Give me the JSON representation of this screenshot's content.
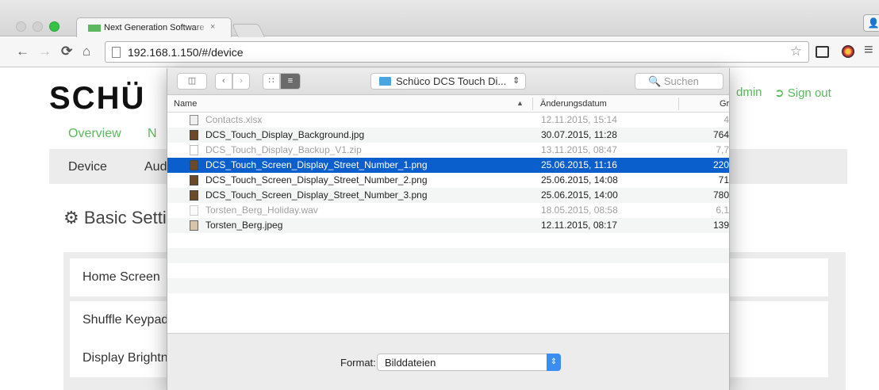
{
  "browser": {
    "tab_title": "Next Generation Software",
    "tab_close": "×",
    "url": "192.168.1.150/#/device",
    "icons": {
      "back": "arrow-left-icon",
      "forward": "arrow-right-icon",
      "reload": "reload-icon",
      "home": "home-icon",
      "bookmark": "star-icon",
      "menu": "hamburger-icon"
    }
  },
  "site": {
    "logo": "SCHÜ",
    "header_links": {
      "admin": "dmin",
      "sign_out": "Sign out"
    },
    "primary_nav": {
      "overview": "Overview",
      "next": "N"
    },
    "sub_nav": {
      "device": "Device",
      "aud": "Aud"
    },
    "section_title": "Basic Settir",
    "settings_rows": [
      "Home Screen",
      "Shuffle Keypad",
      "Display Brightn"
    ],
    "accent_color": "#5cb85c"
  },
  "dialog": {
    "location": "Schüco DCS Touch Di...",
    "search_placeholder": "Suchen",
    "columns": {
      "name": "Name",
      "date": "Änderungsdatum",
      "size": "Gr"
    },
    "files": [
      {
        "name": "Contacts.xlsx",
        "date": "12.11.2015, 15:14",
        "size": "4",
        "state": "dim",
        "icon": "spreadsheet-icon"
      },
      {
        "name": "DCS_Touch_Display_Background.jpg",
        "date": "30.07.2015, 11:28",
        "size": "764",
        "state": "normal",
        "icon": "image-icon"
      },
      {
        "name": "DCS_Touch_Display_Backup_V1.zip",
        "date": "13.11.2015, 08:47",
        "size": "7,7",
        "state": "dim",
        "icon": "zip-icon"
      },
      {
        "name": "DCS_Touch_Screen_Display_Street_Number_1.png",
        "date": "25.06.2015, 11:16",
        "size": "220",
        "state": "selected",
        "icon": "image-icon"
      },
      {
        "name": "DCS_Touch_Screen_Display_Street_Number_2.png",
        "date": "25.06.2015, 14:08",
        "size": "71",
        "state": "normal",
        "icon": "image-icon"
      },
      {
        "name": "DCS_Touch_Screen_Display_Street_Number_3.png",
        "date": "25.06.2015, 14:00",
        "size": "780",
        "state": "normal",
        "icon": "image-icon"
      },
      {
        "name": "Torsten_Berg_Holiday.wav",
        "date": "18.05.2015, 08:58",
        "size": "6,1",
        "state": "dim",
        "icon": "audio-icon"
      },
      {
        "name": "Torsten_Berg.jpeg",
        "date": "12.11.2015, 08:17",
        "size": "139",
        "state": "normal",
        "icon": "image-icon"
      }
    ],
    "format_label": "Format:",
    "format_value": "Bilddateien",
    "selection_color": "#0a5fcd"
  }
}
